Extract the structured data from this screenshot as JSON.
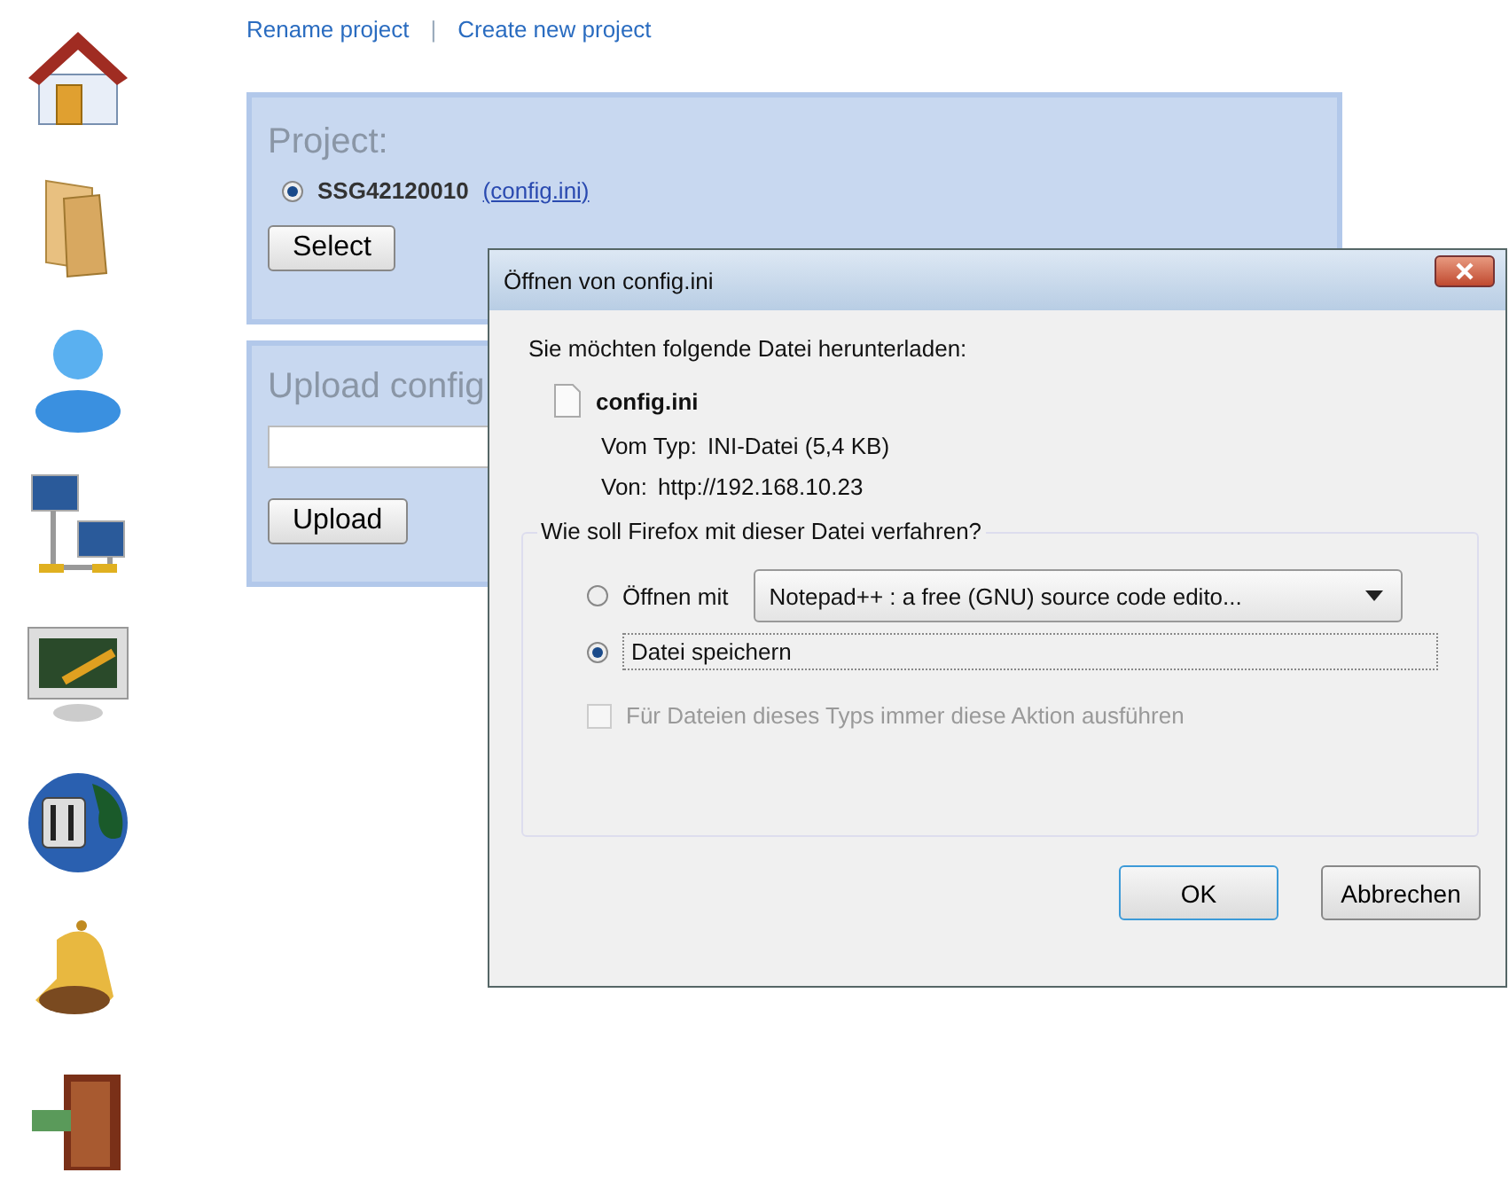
{
  "links": [
    {
      "label": "Rename project"
    },
    {
      "label": "Create new project"
    }
  ],
  "link_separator": "|",
  "project_panel": {
    "title": "Project:",
    "projects": [
      {
        "name": "SSG42120010",
        "file_link": "(config.ini)",
        "selected": true
      }
    ],
    "button": "Select"
  },
  "upload_panel": {
    "title": "Upload config",
    "button": "Upload"
  },
  "dialog": {
    "title": "Öffnen von config.ini",
    "intro": "Sie möchten folgende Datei herunterladen:",
    "file_name": "config.ini",
    "details": [
      {
        "label": "Vom Typ:",
        "value": "INI-Datei (5,4 KB)"
      },
      {
        "label": "Von:",
        "value": "http://192.168.10.23"
      }
    ],
    "group_title": "Wie soll Firefox mit dieser Datei verfahren?",
    "options": [
      {
        "kind": "open_with",
        "label": "Öffnen mit",
        "selected": false,
        "app": "Notepad++ : a free (GNU) source code edito..."
      },
      {
        "kind": "save",
        "label": "Datei speichern",
        "selected": true
      }
    ],
    "remember": {
      "label": "Für Dateien dieses Typs immer diese Aktion ausführen",
      "checked": false,
      "disabled": true
    },
    "buttons": [
      {
        "label": "OK",
        "default": true
      },
      {
        "label": "Abbrechen",
        "default": false
      }
    ]
  }
}
